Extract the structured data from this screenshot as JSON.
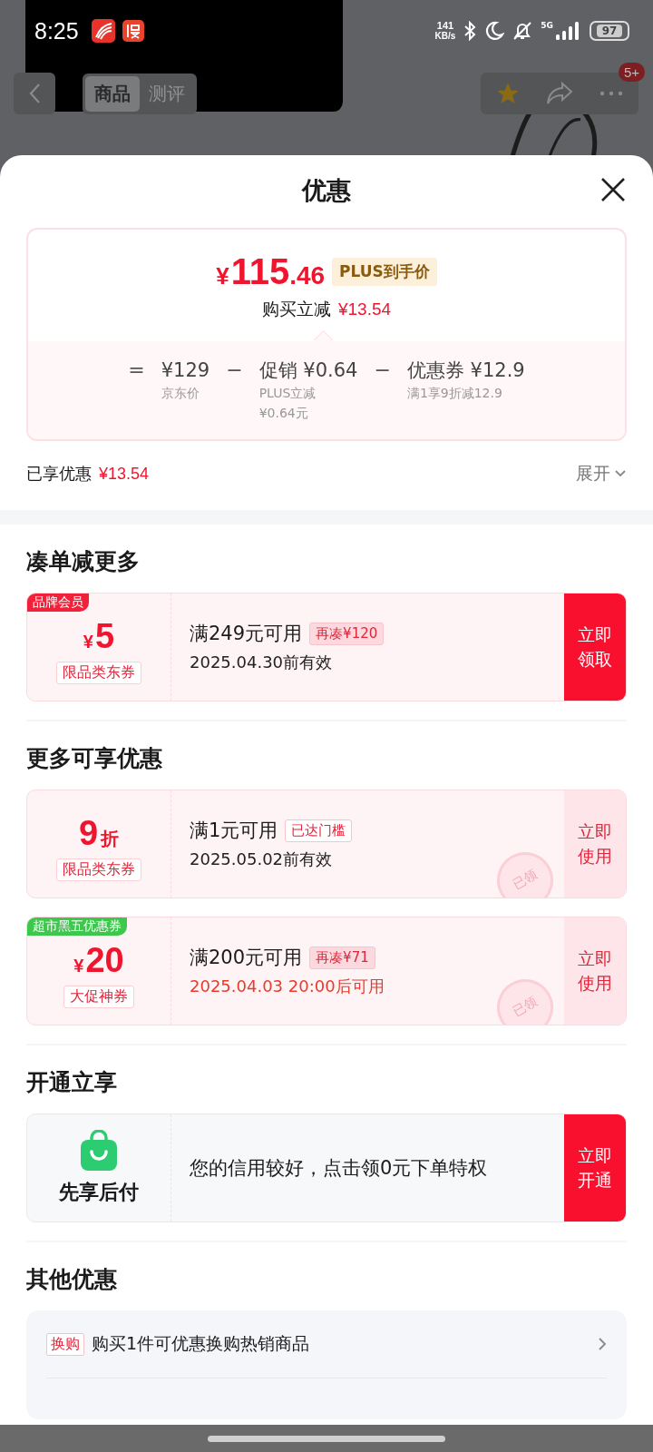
{
  "status_bar": {
    "time": "8:25",
    "speed_value": "141",
    "speed_unit": "KB/s",
    "network": "5G",
    "battery": "97"
  },
  "product_nav": {
    "tabs": [
      {
        "label": "商品",
        "selected": true
      },
      {
        "label": "测评",
        "selected": false
      }
    ],
    "more_badge": "5+"
  },
  "sheet": {
    "title": "优惠",
    "price_card": {
      "currency": "¥",
      "price_int": "115",
      "price_dec": ".46",
      "price_tag": "PLUS到手价",
      "saving_label": "购买立减",
      "saving_amount": "¥13.54",
      "breakdown": [
        {
          "operator": "=",
          "value": "¥129",
          "note_lines": [
            "京东价"
          ]
        },
        {
          "operator": "−",
          "value": "促销 ¥0.64",
          "note_lines": [
            "PLUS立减",
            "¥0.64元"
          ]
        },
        {
          "operator": "−",
          "value": "优惠券 ¥12.9",
          "note_lines": [
            "满1享9折减12.9"
          ]
        }
      ]
    },
    "total": {
      "label": "已享优惠",
      "amount": "¥13.54",
      "toggle": "展开"
    },
    "sections": [
      {
        "kind": "coupons",
        "title": "凑单减更多",
        "coupons": [
          {
            "corner_tag": {
              "text": "品牌会员",
              "color": "#f2213a"
            },
            "currency": "¥",
            "value": "5",
            "scope": "限品类东券",
            "condition": "满249元可用",
            "hint": "再凑¥120",
            "hint_filled": true,
            "validity": "2025.04.30前有效",
            "validity_highlight": false,
            "action": "立即领取",
            "action_primary": true
          }
        ]
      },
      {
        "kind": "coupons",
        "title": "更多可享优惠",
        "coupons": [
          {
            "value": "9",
            "unit": "折",
            "scope": "限品类东券",
            "condition": "满1元可用",
            "hint": "已达门槛",
            "hint_filled": false,
            "validity": "2025.05.02前有效",
            "validity_highlight": false,
            "action": "立即使用",
            "action_primary": false,
            "stamp": "已领"
          },
          {
            "corner_tag": {
              "text": "超市黑五优惠券",
              "color": "#3cc84b"
            },
            "currency": "¥",
            "value": "20",
            "scope": "大促神券",
            "condition": "满200元可用",
            "hint": "再凑¥71",
            "hint_filled": true,
            "validity": "2025.04.03 20:00后可用",
            "validity_highlight": true,
            "action": "立即使用",
            "action_primary": false,
            "stamp": "已领"
          }
        ]
      },
      {
        "kind": "service",
        "title": "开通立享",
        "name": "先享后付",
        "text": "您的信用较好，点击领0元下单特权",
        "action": "立即开通"
      },
      {
        "kind": "list",
        "title": "其他优惠",
        "rows": [
          {
            "tag": "换购",
            "text": "购买1件可优惠换购热销商品"
          }
        ]
      }
    ]
  }
}
